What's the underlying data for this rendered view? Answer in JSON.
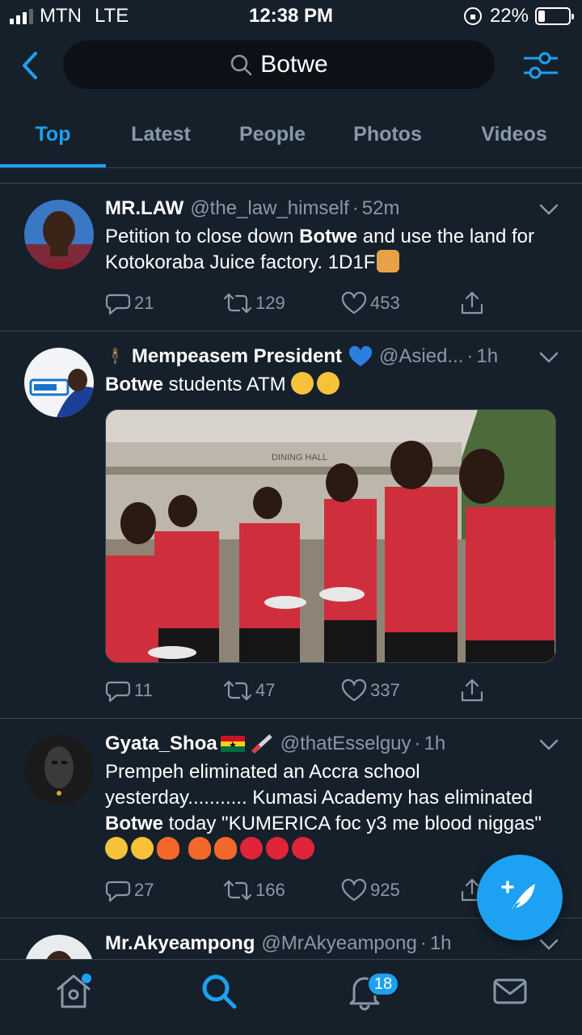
{
  "status_bar": {
    "carrier": "MTN",
    "network": "LTE",
    "time": "12:38 PM",
    "battery": "22%",
    "battery_level": 0.22
  },
  "search": {
    "query": "Botwe"
  },
  "tabs": [
    {
      "label": "Top",
      "active": true
    },
    {
      "label": "Latest",
      "active": false
    },
    {
      "label": "People",
      "active": false
    },
    {
      "label": "Photos",
      "active": false
    },
    {
      "label": "Videos",
      "active": false
    }
  ],
  "tweets": [
    {
      "name": "MR.LAW",
      "handle": "@the_law_himself",
      "time": "52m",
      "text_before": "Petition to close down ",
      "text_bold": "Botwe",
      "text_after": " and use the land for Kotokoraba Juice factory. 1D1F",
      "replies": "21",
      "retweets": "129",
      "likes": "453"
    },
    {
      "name": "Mempeasem President",
      "handle": "@Asied...",
      "time": "1h",
      "text_bold": "Botwe",
      "text_after": " students ATM",
      "image_sign": "DINING HALL",
      "replies": "11",
      "retweets": "47",
      "likes": "337"
    },
    {
      "name": "Gyata_Shoa",
      "handle": "@thatEsselguy",
      "time": "1h",
      "text_before": "Prempeh eliminated an Accra school yesterday........... Kumasi Academy has eliminated ",
      "text_bold": "Botwe",
      "text_after": " today \"KUMERICA foc y3 me blood niggas\"",
      "replies": "27",
      "retweets": "166",
      "likes": "925"
    },
    {
      "name": "Mr.Akyeampong",
      "handle": "@MrAkyeampong",
      "time": "1h"
    }
  ],
  "bottom_nav": {
    "notifications_badge": "18"
  },
  "colors": {
    "background": "#15202b",
    "accent": "#1da1f2",
    "secondary_text": "#8899a6",
    "divider": "#38444d"
  }
}
